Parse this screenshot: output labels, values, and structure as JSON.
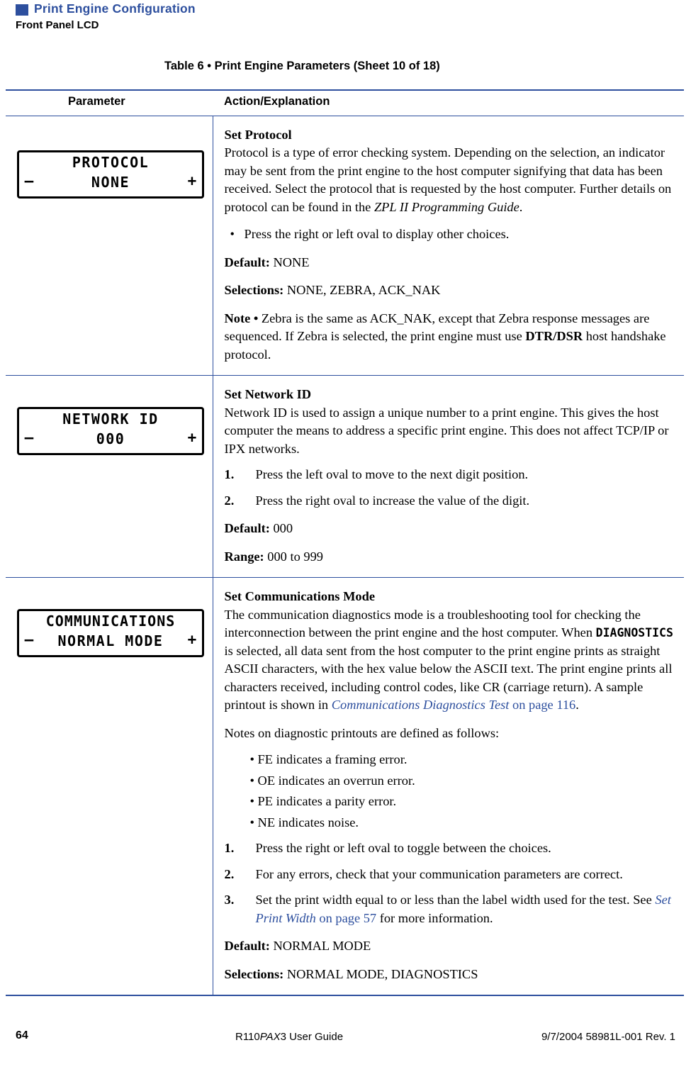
{
  "header": {
    "title": "Print Engine Configuration",
    "subtitle": "Front Panel LCD"
  },
  "table": {
    "caption": "Table 6 • Print Engine Parameters (Sheet 10 of 18)",
    "columns": [
      "Parameter",
      "Action/Explanation"
    ],
    "rows": [
      {
        "lcd": {
          "line1": "PROTOCOL",
          "line2": "NONE",
          "minus": "–",
          "plus": "+"
        },
        "heading": "Set Protocol",
        "body1": "Protocol is a type of error checking system. Depending on the selection, an indicator may be sent from the print engine to the host computer signifying that data has been received. Select the protocol that is requested by the host computer. Further details on protocol can be found in the ",
        "body1_italic": "ZPL II Programming Guide",
        "body1_end": ".",
        "bullet": "Press the right or left oval to display other choices.",
        "default_label": "Default:",
        "default_value": " NONE",
        "selections_label": "Selections:",
        "selections_value": " NONE, ZEBRA, ACK_NAK",
        "note_label": "Note •",
        "note_text": " Zebra is the same as ACK_NAK, except that Zebra response messages are sequenced. If Zebra is selected, the print engine must use ",
        "note_bold": "DTR/DSR",
        "note_end": " host handshake protocol."
      },
      {
        "lcd": {
          "line1": "NETWORK ID",
          "line2": "000",
          "minus": "–",
          "plus": "+"
        },
        "heading": "Set Network ID",
        "body1": "Network ID is used to assign a unique number to a print engine. This gives the host computer the means to address a specific print engine. This does not affect TCP/IP or IPX networks.",
        "steps": [
          {
            "num": "1.",
            "text": "Press the left oval to move to the next digit position."
          },
          {
            "num": "2.",
            "text": "Press the right oval to increase the value of the digit."
          }
        ],
        "default_label": "Default:",
        "default_value": " 000",
        "range_label": "Range:",
        "range_value": " 000 to 999"
      },
      {
        "lcd": {
          "line1": "COMMUNICATIONS",
          "line2": "NORMAL MODE",
          "minus": "–",
          "plus": "+"
        },
        "heading": "Set Communications Mode",
        "body_a": "The communication diagnostics mode is a troubleshooting tool for checking the interconnection between the print engine and the host computer. When ",
        "body_mono": "DIAGNOSTICS",
        "body_b": " is selected, all data sent from the host computer to the print engine prints as straight ASCII characters, with the hex value below the ASCII text. The print engine prints all characters received, including control codes, like CR (carriage return). A sample printout is shown in ",
        "body_link": "Communications Diagnostics Test",
        "body_link2": " on page 116",
        "body_c": ".",
        "notes_intro": "Notes on diagnostic printouts are defined as follows:",
        "sub_bullets": [
          "• FE indicates a framing error.",
          "• OE indicates an overrun error.",
          "• PE indicates a parity error.",
          "• NE indicates noise."
        ],
        "steps": [
          {
            "num": "1.",
            "text": "Press the right or left oval to toggle between the choices."
          },
          {
            "num": "2.",
            "text": "For any errors, check that your communication parameters are correct."
          },
          {
            "num": "3.",
            "text": "Set the print width equal to or less than the label width used for the test. See "
          }
        ],
        "step3_link": "Set Print Width",
        "step3_link2": " on page 57",
        "step3_end": " for more information.",
        "default_label": "Default:",
        "default_value": " NORMAL MODE",
        "selections_label": "Selections:",
        "selections_value": " NORMAL MODE, DIAGNOSTICS"
      }
    ]
  },
  "footer": {
    "page_number": "64",
    "center_a": "R110",
    "center_b": "PAX",
    "center_c": "3 User Guide",
    "right": "9/7/2004    58981L-001 Rev. 1"
  }
}
